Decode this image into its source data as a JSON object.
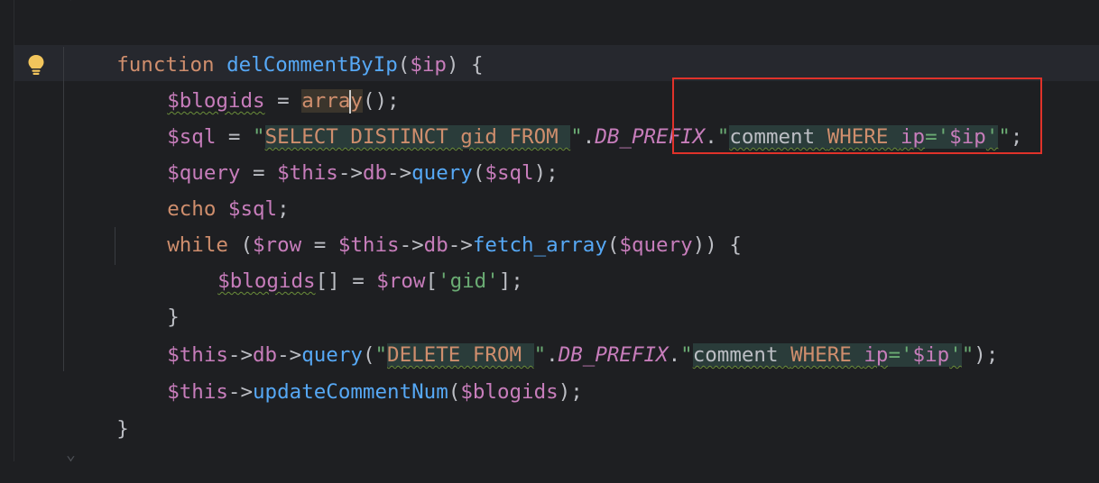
{
  "editor": {
    "colors": {
      "background": "#1e1f22",
      "keyword": "#cf8e6d",
      "function": "#56a8f5",
      "variable": "#c77dbb",
      "string": "#6aab73",
      "annotation_box": "#e0322a"
    },
    "code": {
      "l1": {
        "kw": "function",
        "name": "delCommentByIp",
        "p1": "(",
        "param": "$ip",
        "p2": ") {"
      },
      "l2": {
        "var": "$blogids",
        "eq": " = ",
        "fn_a": "arra",
        "fn_b": "y",
        "end": "();"
      },
      "l3": {
        "var": "$sql",
        "eq": " = ",
        "q1": "\"",
        "s1": "SELECT DISTINCT gid FROM ",
        "q2": "\"",
        "dot1": ".",
        "const": "DB_PREFIX",
        "dot2": ".",
        "q3": "\"",
        "s2a": "comment ",
        "s2b": "WHERE ",
        "s2c": "ip",
        "s2d": "='",
        "s2e": "$ip",
        "s2f": "'",
        "q4": "\"",
        "end": ";"
      },
      "l4": {
        "var": "$query",
        "eq": " = ",
        "this": "$this",
        "a1": "->",
        "db": "db",
        "a2": "->",
        "fn": "query",
        "p1": "(",
        "arg": "$sql",
        "p2": ");"
      },
      "l5": {
        "kw": "echo",
        "sp": " ",
        "var": "$sql",
        "end": ";"
      },
      "l6": {
        "kw": "while",
        "p1": " (",
        "row": "$row",
        "eq": " = ",
        "this": "$this",
        "a1": "->",
        "db": "db",
        "a2": "->",
        "fn": "fetch_array",
        "p2": "(",
        "arg": "$query",
        "p3": ")) {"
      },
      "l7": {
        "var": "$blogids",
        "b": "[] = ",
        "row": "$row",
        "o": "[",
        "key": "'gid'",
        "c": "];"
      },
      "l8": {
        "brace": "}"
      },
      "l9": {
        "this": "$this",
        "a1": "->",
        "db": "db",
        "a2": "->",
        "fn": "query",
        "p1": "(",
        "q1": "\"",
        "s1": "DELETE FROM ",
        "q2": "\"",
        "dot1": ".",
        "const": "DB_PREFIX",
        "dot2": ".",
        "q3": "\"",
        "s2a": "comment ",
        "s2b": "WHERE ",
        "s2c": "ip",
        "s2d": "='",
        "s2e": "$ip",
        "s2f": "'",
        "q4": "\"",
        "end": ");"
      },
      "l10": {
        "this": "$this",
        "a1": "->",
        "fn": "updateCommentNum",
        "p1": "(",
        "arg": "$blogids",
        "p2": ");"
      },
      "l11": {
        "brace": "}"
      }
    },
    "icons": {
      "intention": "lightbulb-icon"
    }
  }
}
